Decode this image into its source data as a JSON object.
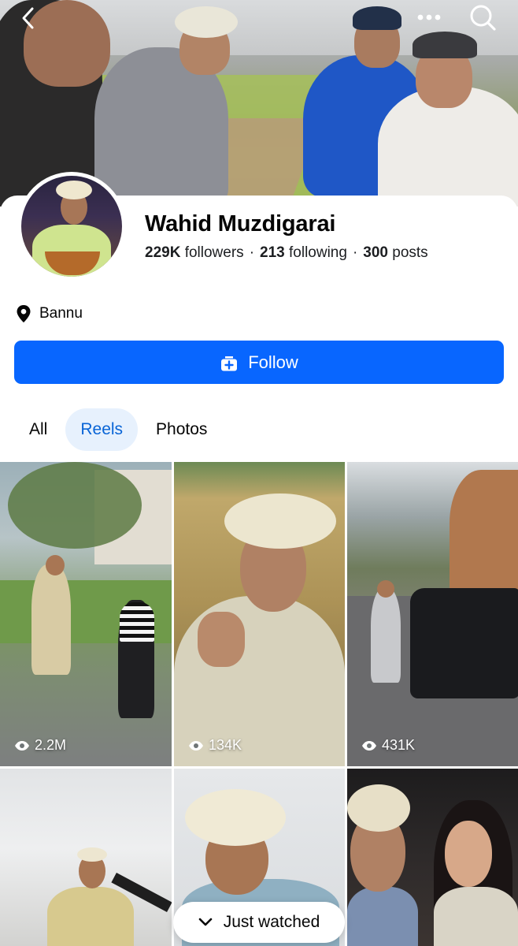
{
  "header": {
    "back_icon": "chevron-left-icon",
    "more_icon": "more-dots-icon",
    "search_icon": "search-icon"
  },
  "profile": {
    "name": "Wahid Muzdigarai",
    "followers_count": "229K",
    "followers_label": "followers",
    "following_count": "213",
    "following_label": "following",
    "posts_count": "300",
    "posts_label": "posts",
    "separator": "·",
    "location": "Bannu",
    "location_icon": "map-pin-icon"
  },
  "follow_button": {
    "label": "Follow",
    "icon": "follow-add-icon",
    "color": "#0866ff"
  },
  "tabs": [
    {
      "label": "All",
      "active": false
    },
    {
      "label": "Reels",
      "active": true
    },
    {
      "label": "Photos",
      "active": false
    }
  ],
  "reels": [
    {
      "views": "2.2M"
    },
    {
      "views": "134K"
    },
    {
      "views": "431K"
    },
    {
      "views": ""
    },
    {
      "views": ""
    },
    {
      "views": ""
    }
  ],
  "just_watched": {
    "label": "Just watched",
    "icon": "chevron-down-icon"
  }
}
